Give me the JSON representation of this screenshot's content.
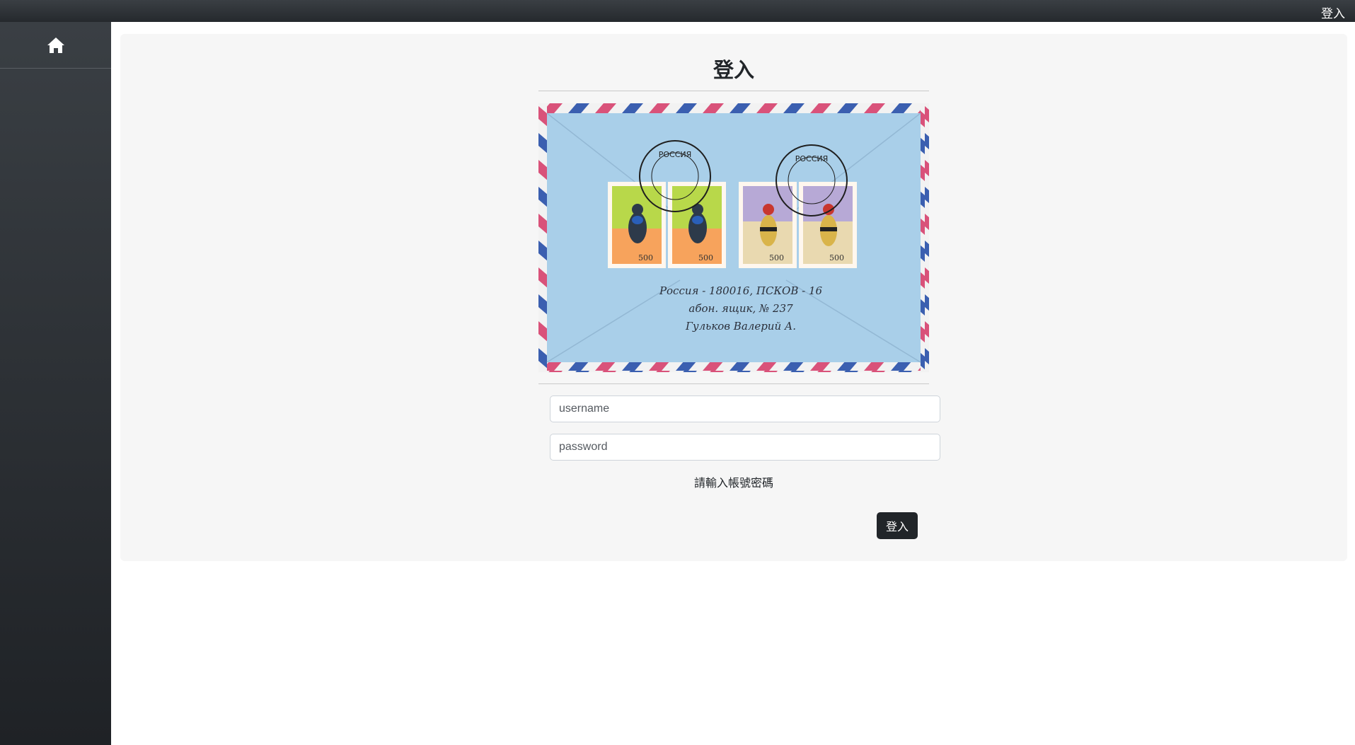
{
  "header": {
    "login_label": "登入"
  },
  "sidebar": {
    "home_icon": "home-icon"
  },
  "login": {
    "title": "登入",
    "username_placeholder": "username",
    "password_placeholder": "password",
    "hint": "請輸入帳號密碼",
    "submit_label": "登入"
  },
  "envelope": {
    "address_line1": "Россия - 180016, ПСКОВ - 16",
    "address_line2": "абон. ящик, № 237",
    "address_line3": "Гульков Валерий А.",
    "stamp_denomination": "500",
    "stamp_country": "РОССИЯ",
    "postmark_text": "РОССИЯ"
  },
  "colors": {
    "topbar": "#2f3337",
    "sidebar": "#2a2e32",
    "panel": "#f6f6f6",
    "button": "#212529",
    "envelope": "#a9cfe9",
    "stripe_red": "#d9527a",
    "stripe_blue": "#3b5fb0"
  }
}
